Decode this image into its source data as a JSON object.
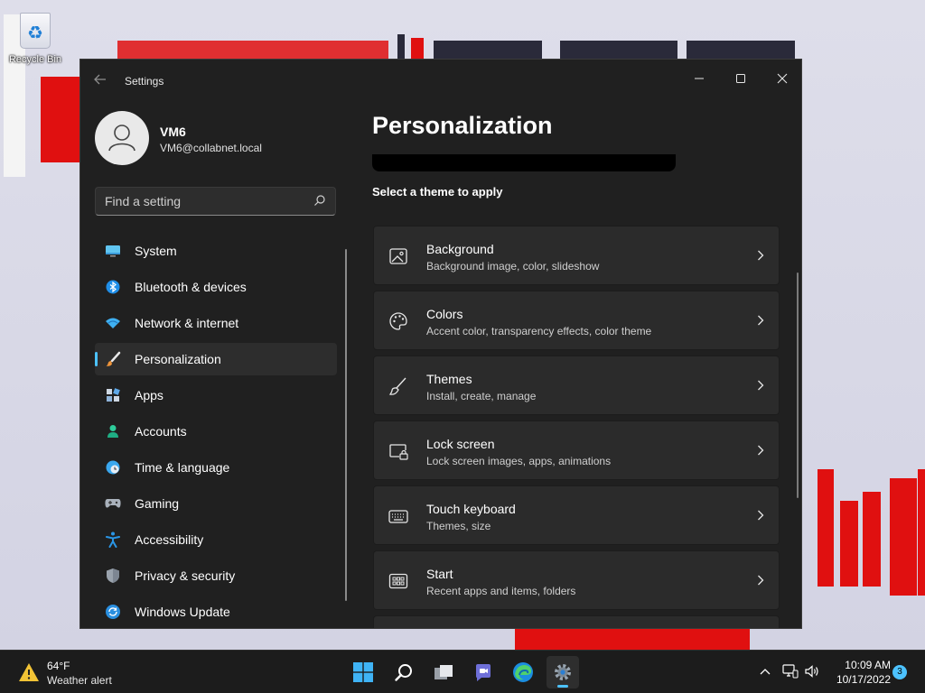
{
  "desktop": {
    "recycle_bin_label": "Recycle Bin"
  },
  "window": {
    "title": "Settings",
    "user": {
      "name": "VM6",
      "email": "VM6@collabnet.local"
    },
    "search": {
      "placeholder": "Find a setting"
    },
    "nav": [
      {
        "label": "System",
        "icon": "monitor-icon"
      },
      {
        "label": "Bluetooth & devices",
        "icon": "bluetooth-icon"
      },
      {
        "label": "Network & internet",
        "icon": "wifi-icon"
      },
      {
        "label": "Personalization",
        "icon": "paintbrush-icon",
        "active": true
      },
      {
        "label": "Apps",
        "icon": "apps-icon"
      },
      {
        "label": "Accounts",
        "icon": "person-icon"
      },
      {
        "label": "Time & language",
        "icon": "globe-clock-icon"
      },
      {
        "label": "Gaming",
        "icon": "gamepad-icon"
      },
      {
        "label": "Accessibility",
        "icon": "accessibility-icon"
      },
      {
        "label": "Privacy & security",
        "icon": "shield-icon"
      },
      {
        "label": "Windows Update",
        "icon": "sync-icon"
      }
    ],
    "page_title": "Personalization",
    "section_label": "Select a theme to apply",
    "cards": [
      {
        "title": "Background",
        "subtitle": "Background image, color, slideshow",
        "icon": "image-icon"
      },
      {
        "title": "Colors",
        "subtitle": "Accent color, transparency effects, color theme",
        "icon": "palette-icon"
      },
      {
        "title": "Themes",
        "subtitle": "Install, create, manage",
        "icon": "brush-icon"
      },
      {
        "title": "Lock screen",
        "subtitle": "Lock screen images, apps, animations",
        "icon": "lock-screen-icon"
      },
      {
        "title": "Touch keyboard",
        "subtitle": "Themes, size",
        "icon": "keyboard-icon"
      },
      {
        "title": "Start",
        "subtitle": "Recent apps and items, folders",
        "icon": "start-icon"
      }
    ]
  },
  "taskbar": {
    "weather": {
      "temp": "64°F",
      "alert": "Weather alert"
    },
    "clock": {
      "time": "10:09 AM",
      "date": "10/17/2022"
    },
    "notifications": "3"
  },
  "colors": {
    "accent": "#4cc2ff",
    "window_bg": "#202020",
    "card_bg": "#2b2b2b"
  }
}
